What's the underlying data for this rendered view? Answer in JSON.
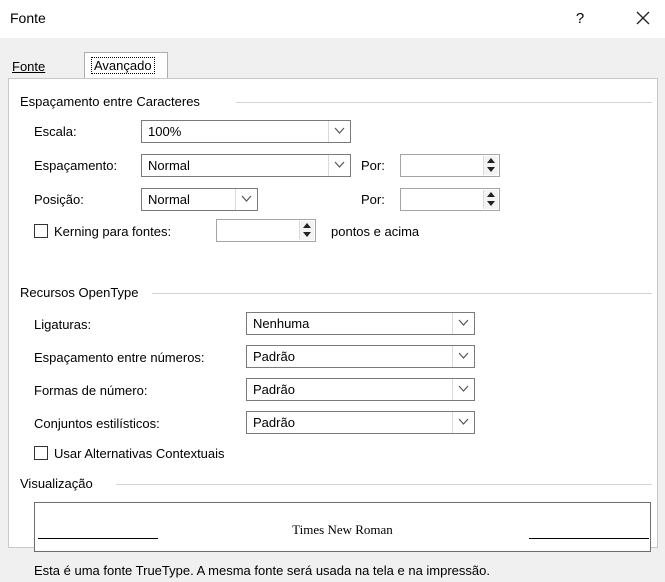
{
  "window": {
    "title": "Fonte",
    "help_label": "?",
    "close_icon": "close-icon"
  },
  "tabs": [
    {
      "label": "Fonte"
    },
    {
      "label": "Avançado",
      "active": true
    }
  ],
  "char_spacing": {
    "group_title": "Espaçamento entre Caracteres",
    "scale": {
      "label": "Escala:",
      "value": "100%"
    },
    "spacing": {
      "label": "Espaçamento:",
      "value": "Normal",
      "by_label": "Por:",
      "by_value": ""
    },
    "position": {
      "label": "Posição:",
      "value": "Normal",
      "by_label": "Por:",
      "by_value": ""
    },
    "kerning": {
      "label": "Kerning para fontes:",
      "checked": false,
      "value": "",
      "suffix": "pontos e acima"
    }
  },
  "opentype": {
    "group_title": "Recursos OpenType",
    "ligatures": {
      "label": "Ligaturas:",
      "value": "Nenhuma"
    },
    "number_spacing": {
      "label": "Espaçamento entre números:",
      "value": "Padrão"
    },
    "number_forms": {
      "label": "Formas de número:",
      "value": "Padrão"
    },
    "stylistic_sets": {
      "label": "Conjuntos estilísticos:",
      "value": "Padrão"
    },
    "contextual_alternates": {
      "label": "Usar Alternativas Contextuais",
      "checked": false
    }
  },
  "preview": {
    "group_title": "Visualização",
    "sample_text": "Times New Roman",
    "description": "Esta é uma fonte TrueType. A mesma fonte será usada na tela e na impressão."
  }
}
